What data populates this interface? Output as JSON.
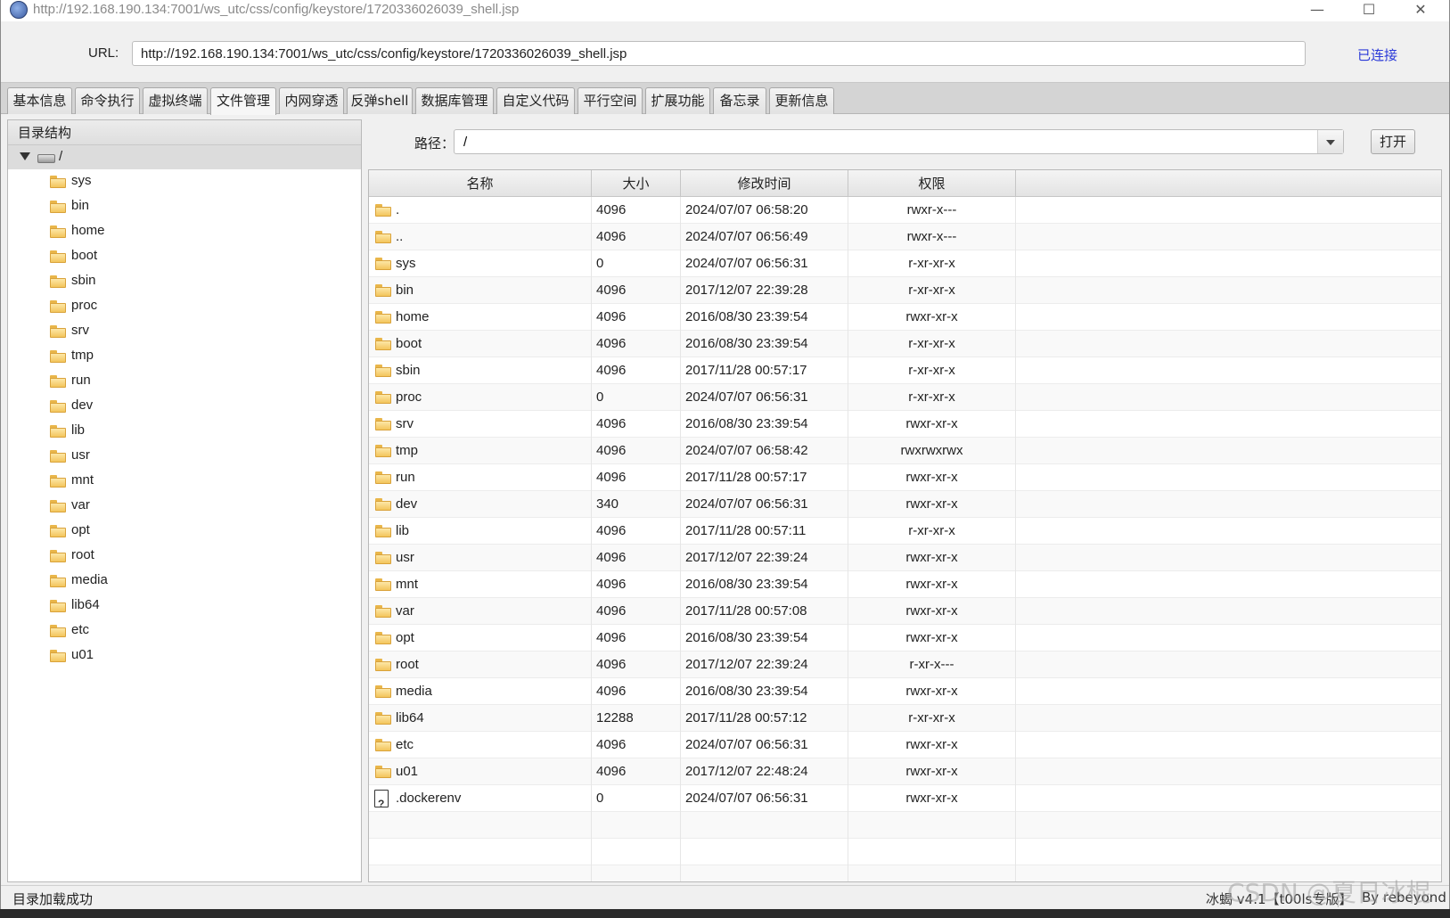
{
  "window": {
    "title": "http://192.168.190.134:7001/ws_utc/css/config/keystore/1720336026039_shell.jsp",
    "controls": {
      "minimize": "—",
      "maximize": "☐",
      "close": "✕"
    }
  },
  "connection": {
    "url_label": "URL:",
    "url_value": "http://192.168.190.134:7001/ws_utc/css/config/keystore/1720336026039_shell.jsp",
    "status": "已连接"
  },
  "tabs": [
    {
      "label": "基本信息"
    },
    {
      "label": "命令执行"
    },
    {
      "label": "虚拟终端"
    },
    {
      "label": "文件管理",
      "active": true
    },
    {
      "label": "内网穿透"
    },
    {
      "label": "反弹shell"
    },
    {
      "label": "数据库管理"
    },
    {
      "label": "自定义代码"
    },
    {
      "label": "平行空间"
    },
    {
      "label": "扩展功能"
    },
    {
      "label": "备忘录"
    },
    {
      "label": "更新信息"
    }
  ],
  "tree": {
    "header": "目录结构",
    "root": "/",
    "items": [
      "sys",
      "bin",
      "home",
      "boot",
      "sbin",
      "proc",
      "srv",
      "tmp",
      "run",
      "dev",
      "lib",
      "usr",
      "mnt",
      "var",
      "opt",
      "root",
      "media",
      "lib64",
      "etc",
      "u01"
    ]
  },
  "path": {
    "label": "路径：",
    "value": "/",
    "open_button": "打开"
  },
  "table": {
    "columns": [
      "名称",
      "大小",
      "修改时间",
      "权限"
    ],
    "rows": [
      {
        "name": ".",
        "size": "4096",
        "mtime": "2024/07/07 06:58:20",
        "perm": "rwxr-x---",
        "type": "folder"
      },
      {
        "name": "..",
        "size": "4096",
        "mtime": "2024/07/07 06:56:49",
        "perm": "rwxr-x---",
        "type": "folder"
      },
      {
        "name": "sys",
        "size": "0",
        "mtime": "2024/07/07 06:56:31",
        "perm": "r-xr-xr-x",
        "type": "folder"
      },
      {
        "name": "bin",
        "size": "4096",
        "mtime": "2017/12/07 22:39:28",
        "perm": "r-xr-xr-x",
        "type": "folder"
      },
      {
        "name": "home",
        "size": "4096",
        "mtime": "2016/08/30 23:39:54",
        "perm": "rwxr-xr-x",
        "type": "folder"
      },
      {
        "name": "boot",
        "size": "4096",
        "mtime": "2016/08/30 23:39:54",
        "perm": "r-xr-xr-x",
        "type": "folder"
      },
      {
        "name": "sbin",
        "size": "4096",
        "mtime": "2017/11/28 00:57:17",
        "perm": "r-xr-xr-x",
        "type": "folder"
      },
      {
        "name": "proc",
        "size": "0",
        "mtime": "2024/07/07 06:56:31",
        "perm": "r-xr-xr-x",
        "type": "folder"
      },
      {
        "name": "srv",
        "size": "4096",
        "mtime": "2016/08/30 23:39:54",
        "perm": "rwxr-xr-x",
        "type": "folder"
      },
      {
        "name": "tmp",
        "size": "4096",
        "mtime": "2024/07/07 06:58:42",
        "perm": "rwxrwxrwx",
        "type": "folder"
      },
      {
        "name": "run",
        "size": "4096",
        "mtime": "2017/11/28 00:57:17",
        "perm": "rwxr-xr-x",
        "type": "folder"
      },
      {
        "name": "dev",
        "size": "340",
        "mtime": "2024/07/07 06:56:31",
        "perm": "rwxr-xr-x",
        "type": "folder"
      },
      {
        "name": "lib",
        "size": "4096",
        "mtime": "2017/11/28 00:57:11",
        "perm": "r-xr-xr-x",
        "type": "folder"
      },
      {
        "name": "usr",
        "size": "4096",
        "mtime": "2017/12/07 22:39:24",
        "perm": "rwxr-xr-x",
        "type": "folder"
      },
      {
        "name": "mnt",
        "size": "4096",
        "mtime": "2016/08/30 23:39:54",
        "perm": "rwxr-xr-x",
        "type": "folder"
      },
      {
        "name": "var",
        "size": "4096",
        "mtime": "2017/11/28 00:57:08",
        "perm": "rwxr-xr-x",
        "type": "folder"
      },
      {
        "name": "opt",
        "size": "4096",
        "mtime": "2016/08/30 23:39:54",
        "perm": "rwxr-xr-x",
        "type": "folder"
      },
      {
        "name": "root",
        "size": "4096",
        "mtime": "2017/12/07 22:39:24",
        "perm": "r-xr-x---",
        "type": "folder"
      },
      {
        "name": "media",
        "size": "4096",
        "mtime": "2016/08/30 23:39:54",
        "perm": "rwxr-xr-x",
        "type": "folder"
      },
      {
        "name": "lib64",
        "size": "12288",
        "mtime": "2017/11/28 00:57:12",
        "perm": "r-xr-xr-x",
        "type": "folder"
      },
      {
        "name": "etc",
        "size": "4096",
        "mtime": "2024/07/07 06:56:31",
        "perm": "rwxr-xr-x",
        "type": "folder"
      },
      {
        "name": "u01",
        "size": "4096",
        "mtime": "2017/12/07 22:48:24",
        "perm": "rwxr-xr-x",
        "type": "folder"
      },
      {
        "name": ".dockerenv",
        "size": "0",
        "mtime": "2024/07/07 06:56:31",
        "perm": "rwxr-xr-x",
        "type": "file"
      }
    ]
  },
  "statusbar": {
    "message": "目录加载成功",
    "version": "冰蝎 v4.1【t00ls专版】",
    "author": "By rebeyond"
  },
  "watermark": "CSDN @夏日冰棍"
}
